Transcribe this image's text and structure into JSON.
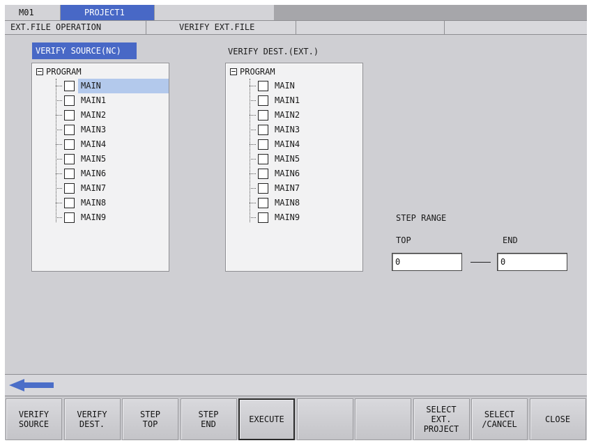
{
  "topbar": {
    "tabs": [
      "M01",
      "PROJECT1",
      ""
    ]
  },
  "breadcrumb": {
    "items": [
      "EXT.FILE OPERATION",
      "VERIFY EXT.FILE",
      "",
      ""
    ]
  },
  "source": {
    "label": "VERIFY SOURCE(NC)",
    "root": "PROGRAM",
    "items": [
      "MAIN",
      "MAIN1",
      "MAIN2",
      "MAIN3",
      "MAIN4",
      "MAIN5",
      "MAIN6",
      "MAIN7",
      "MAIN8",
      "MAIN9"
    ],
    "selected_index": 0
  },
  "dest": {
    "label": "VERIFY DEST.(EXT.)",
    "root": "PROGRAM",
    "items": [
      "MAIN",
      "MAIN1",
      "MAIN2",
      "MAIN3",
      "MAIN4",
      "MAIN5",
      "MAIN6",
      "MAIN7",
      "MAIN8",
      "MAIN9"
    ]
  },
  "step_range": {
    "label": "STEP RANGE",
    "top_label": "TOP",
    "end_label": "END",
    "top_value": "0",
    "end_value": "0"
  },
  "arrow_row": {
    "icon": "back-arrow-icon",
    "color": "#4b6ec8"
  },
  "fkeys": [
    "VERIFY\nSOURCE",
    "VERIFY\nDEST.",
    "STEP\nTOP",
    "STEP\nEND",
    "EXECUTE",
    "",
    "",
    "SELECT\nEXT.\nPROJECT",
    "SELECT\n/CANCEL",
    "CLOSE"
  ],
  "colors": {
    "accent": "#4868c6",
    "selection": "#b3c9ec",
    "background": "#cfcfd3"
  }
}
